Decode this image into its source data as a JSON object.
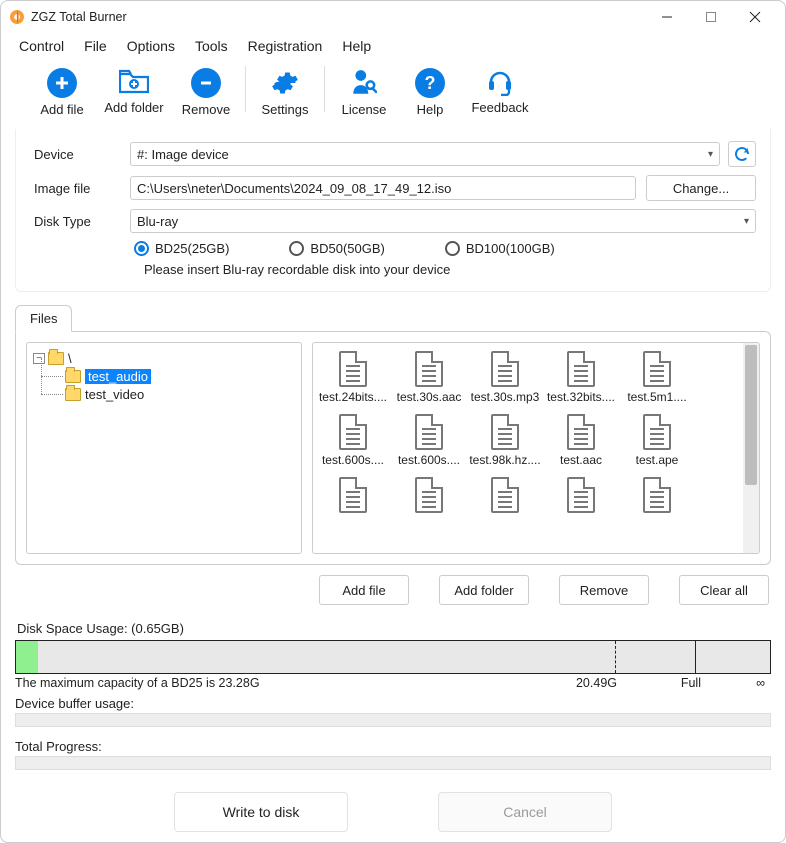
{
  "window": {
    "title": "ZGZ Total Burner"
  },
  "menu": {
    "items": [
      "Control",
      "File",
      "Options",
      "Tools",
      "Registration",
      "Help"
    ]
  },
  "toolbar": {
    "add_file": "Add file",
    "add_folder": "Add folder",
    "remove": "Remove",
    "settings": "Settings",
    "license": "License",
    "help": "Help",
    "feedback": "Feedback"
  },
  "form": {
    "device_label": "Device",
    "device_value": "#: Image device",
    "image_label": "Image file",
    "image_value": "C:\\Users\\neter\\Documents\\2024_09_08_17_49_12.iso",
    "change_btn": "Change...",
    "disk_type_label": "Disk Type",
    "disk_type_value": "Blu-ray",
    "radios": {
      "bd25": "BD25(25GB)",
      "bd50": "BD50(50GB)",
      "bd100": "BD100(100GB)"
    },
    "hint": "Please insert Blu-ray recordable disk into your device"
  },
  "files": {
    "tab": "Files",
    "root": "\\",
    "tree": {
      "n1": "test_audio",
      "n2": "test_video"
    },
    "items": [
      "test.24bits....",
      "test.30s.aac",
      "test.30s.mp3",
      "test.32bits....",
      "test.5m1....",
      "test.600s....",
      "test.600s....",
      "test.98k.hz....",
      "test.aac",
      "test.ape",
      "",
      "",
      "",
      "",
      ""
    ],
    "add_file": "Add file",
    "add_folder": "Add folder",
    "remove": "Remove",
    "clear_all": "Clear all"
  },
  "usage": {
    "label": "Disk Space Usage:  (0.65GB)",
    "cap": "The maximum capacity of a BD25 is 23.28G",
    "m1": "20.49G",
    "m2": "Full",
    "m3": "∞"
  },
  "buffer": {
    "label": "Device buffer usage:"
  },
  "progress": {
    "label": "Total Progress:"
  },
  "actions": {
    "write": "Write to disk",
    "cancel": "Cancel"
  }
}
